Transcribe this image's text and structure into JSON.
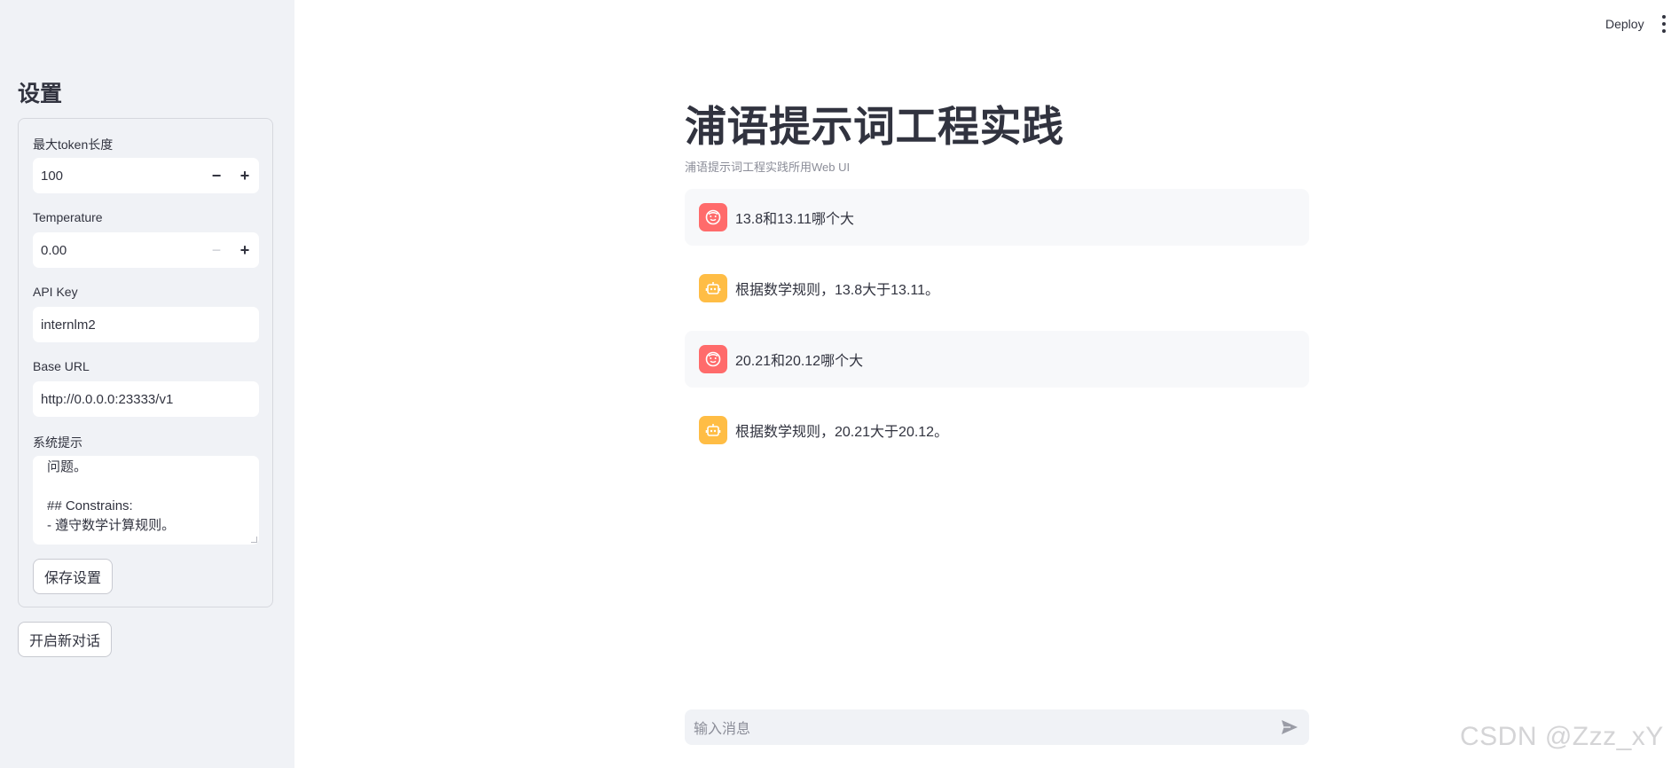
{
  "sidebar": {
    "title": "设置",
    "max_tokens": {
      "label": "最大token长度",
      "value": "100"
    },
    "temperature": {
      "label": "Temperature",
      "value": "0.00"
    },
    "api_key": {
      "label": "API Key",
      "value": "internlm2"
    },
    "base_url": {
      "label": "Base URL",
      "value": "http://0.0.0.0:23333/v1"
    },
    "system_prompt": {
      "label": "系统提示",
      "lines": [
        "问题。",
        "",
        "## Constrains:",
        "- 遵守数学计算规则。"
      ]
    },
    "save_label": "保存设置",
    "new_chat_label": "开启新对话"
  },
  "header": {
    "deploy_label": "Deploy"
  },
  "main": {
    "title": "浦语提示词工程实践",
    "caption": "浦语提示词工程实践所用Web UI",
    "messages": [
      {
        "role": "user",
        "text": "13.8和13.11哪个大"
      },
      {
        "role": "assistant",
        "text": "根据数学规则，13.8大于13.11。"
      },
      {
        "role": "user",
        "text": "20.21和20.12哪个大"
      },
      {
        "role": "assistant",
        "text": "根据数学规则，20.21大于20.12。"
      }
    ],
    "chat_input_placeholder": "输入消息"
  },
  "watermark": "CSDN @Zzz_xY",
  "colors": {
    "sidebar_bg": "#f0f2f6",
    "user_avatar": "#ff6b6b",
    "assistant_avatar": "#ffbd45",
    "text": "#31333f"
  }
}
